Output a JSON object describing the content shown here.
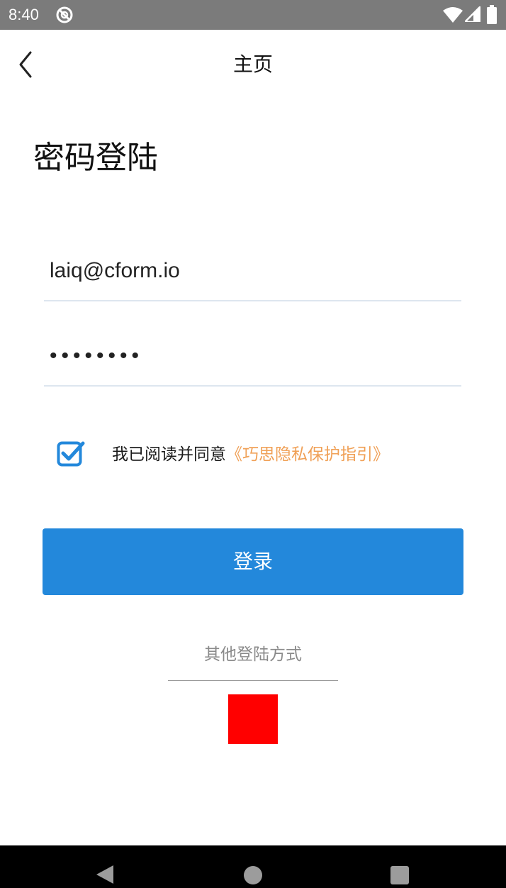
{
  "status_bar": {
    "time": "8:40",
    "icons": [
      "app-notification-icon",
      "wifi-icon",
      "signal-icon",
      "battery-icon"
    ]
  },
  "app_bar": {
    "title": "主页",
    "back_icon": "chevron-left-icon"
  },
  "heading": "密码登陆",
  "form": {
    "email_value": "laiq@cform.io",
    "password_value": "12345678",
    "agreement": {
      "checked": true,
      "text": "我已阅读并同意",
      "link": "《巧思隐私保护指引》"
    },
    "login_label": "登录"
  },
  "other_login": {
    "label": "其他登陆方式"
  },
  "navigation_bar": {
    "icons": [
      "back-triangle-icon",
      "home-circle-icon",
      "recents-square-icon"
    ]
  },
  "colors": {
    "status_bar": "#7b7b7b",
    "accent": "#2388db",
    "link": "#f0a056",
    "other_login_option": "#ff0000",
    "nav_bar": "#000000"
  }
}
